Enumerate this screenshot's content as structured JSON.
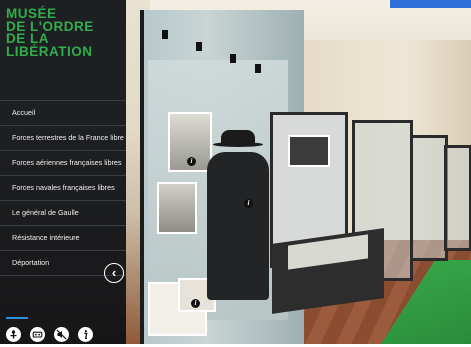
{
  "logo": {
    "lines": [
      "MUSÉE",
      "DE L'ORDRE",
      "DE LA",
      "LIBÉRATION"
    ]
  },
  "menu": {
    "items": [
      {
        "label": "Accueil"
      },
      {
        "label": "Forces terrestres de la France libre"
      },
      {
        "label": "Forces aériennes françaises libres"
      },
      {
        "label": "Forces navales françaises libres"
      },
      {
        "label": "Le général de Gaulle"
      },
      {
        "label": "Résistance intérieure"
      },
      {
        "label": "Déportation"
      }
    ]
  },
  "controls": {
    "collapse_icon": "chevron-left-icon",
    "footer_icons": [
      "gyroscope-icon",
      "vr-headset-icon",
      "mute-sound-icon",
      "info-icon"
    ]
  },
  "colors": {
    "logo_green": "#2fae4c",
    "sidebar_bg": "#0e1014",
    "accent_blue": "#2f8fd8",
    "tab_blue": "#2f6fd8"
  }
}
